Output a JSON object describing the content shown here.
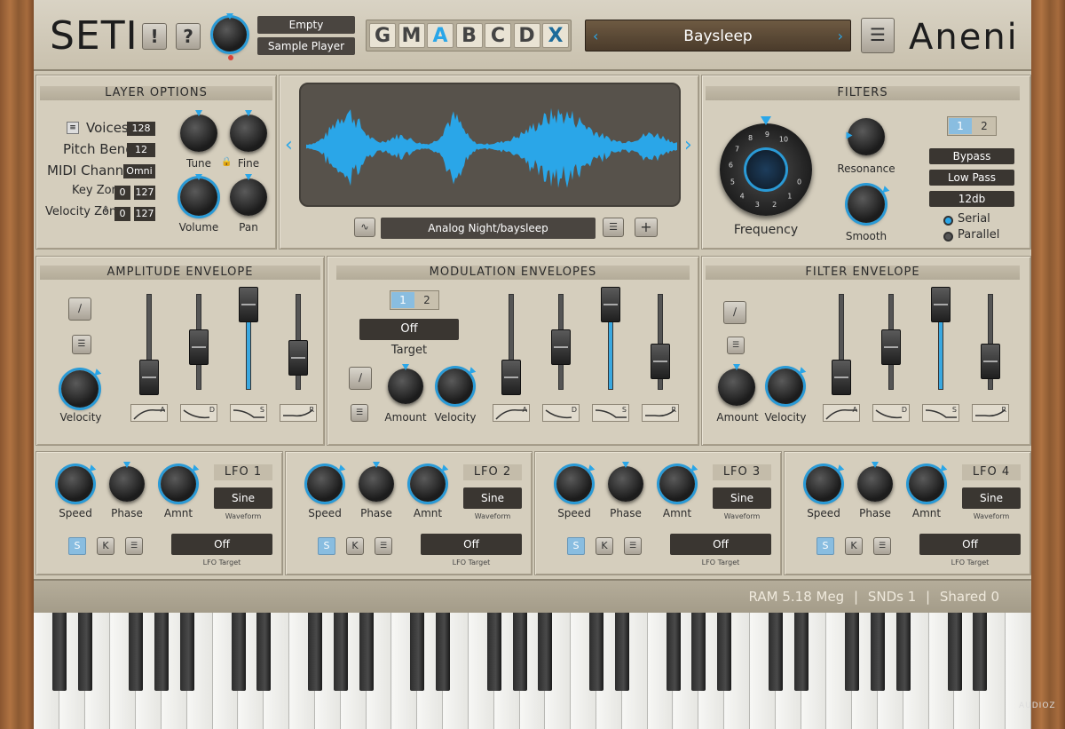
{
  "header": {
    "title": "SETI",
    "btn_excl": "!",
    "btn_help": "?",
    "slot1": "Empty",
    "slot2": "Sample Player",
    "tabs": [
      "G",
      "M",
      "A",
      "B",
      "C",
      "D",
      "X"
    ],
    "active_tab": "A",
    "preset_name": "Baysleep",
    "brand": "Aneni"
  },
  "layer_options": {
    "title": "LAYER OPTIONS",
    "voices_label": "Voices",
    "voices_value": "128",
    "pitch_bend_label": "Pitch Bend",
    "pitch_bend_value": "12",
    "midi_channel_label": "MIDI Channel",
    "midi_channel_value": "Omni",
    "key_zone_label": "Key Zone",
    "key_zone_low": "0",
    "key_zone_high": "127",
    "velocity_zone_label": "Velocity Zone",
    "velocity_zone_low": "0",
    "velocity_zone_high": "127",
    "tune_label": "Tune",
    "fine_label": "Fine",
    "volume_label": "Volume",
    "pan_label": "Pan"
  },
  "waveform": {
    "sample_name": "Analog Night/baysleep"
  },
  "filters": {
    "title": "FILTERS",
    "frequency_label": "Frequency",
    "resonance_label": "Resonance",
    "smooth_label": "Smooth",
    "tab1": "1",
    "tab2": "2",
    "type1": "Bypass",
    "type2": "Low Pass",
    "type3": "12db",
    "serial_label": "Serial",
    "parallel_label": "Parallel",
    "dial_numbers": [
      "10",
      "9",
      "8",
      "7",
      "6",
      "5",
      "4",
      "3",
      "2",
      "1",
      "0"
    ]
  },
  "amp_env": {
    "title": "AMPLITUDE ENVELOPE",
    "velocity_label": "Velocity"
  },
  "mod_env": {
    "title": "MODULATION ENVELOPES",
    "tab1": "1",
    "tab2": "2",
    "target_value": "Off",
    "target_label": "Target",
    "amount_label": "Amount",
    "velocity_label": "Velocity"
  },
  "filter_env": {
    "title": "FILTER ENVELOPE",
    "amount_label": "Amount",
    "velocity_label": "Velocity"
  },
  "env_stages": [
    "A",
    "D",
    "S",
    "R"
  ],
  "lfos": [
    {
      "name": "LFO 1",
      "speed": "Speed",
      "phase": "Phase",
      "amnt": "Amnt",
      "waveform": "Sine",
      "waveform_label": "Waveform",
      "target": "Off",
      "target_label": "LFO Target",
      "s": "S",
      "k": "K"
    },
    {
      "name": "LFO 2",
      "speed": "Speed",
      "phase": "Phase",
      "amnt": "Amnt",
      "waveform": "Sine",
      "waveform_label": "Waveform",
      "target": "Off",
      "target_label": "LFO Target",
      "s": "S",
      "k": "K"
    },
    {
      "name": "LFO 3",
      "speed": "Speed",
      "phase": "Phase",
      "amnt": "Amnt",
      "waveform": "Sine",
      "waveform_label": "Waveform",
      "target": "Off",
      "target_label": "LFO Target",
      "s": "S",
      "k": "K"
    },
    {
      "name": "LFO 4",
      "speed": "Speed",
      "phase": "Phase",
      "amnt": "Amnt",
      "waveform": "Sine",
      "waveform_label": "Waveform",
      "target": "Off",
      "target_label": "LFO Target",
      "s": "S",
      "k": "K"
    }
  ],
  "status": {
    "ram": "RAM 5.18 Meg",
    "snds": "SNDs 1",
    "shared": "Shared 0"
  },
  "watermark": "AUDIOZ",
  "colors": {
    "accent": "#2aa6e8",
    "panel": "#d5cebd",
    "dark": "#3a3631"
  }
}
